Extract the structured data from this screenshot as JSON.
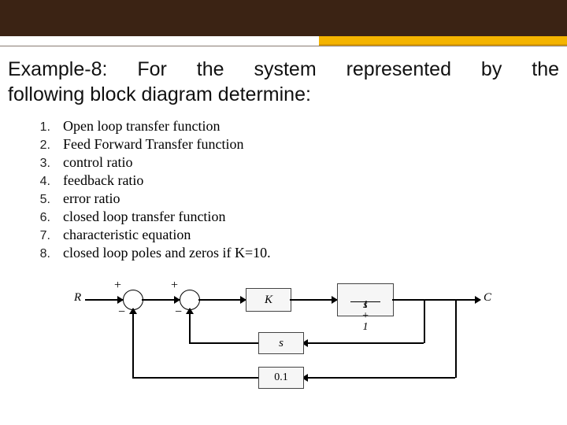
{
  "header": {
    "title_line1": "Example-8: For the system represented by the",
    "title_line2": "following block diagram determine:"
  },
  "list": {
    "items": [
      {
        "n": "1.",
        "text": "Open loop transfer function"
      },
      {
        "n": "2.",
        "text": "Feed Forward Transfer function"
      },
      {
        "n": "3.",
        "text": "control ratio"
      },
      {
        "n": "4.",
        "text": "feedback ratio"
      },
      {
        "n": "5.",
        "text": "error ratio"
      },
      {
        "n": "6.",
        "text": "closed loop transfer function"
      },
      {
        "n": "7.",
        "text": "characteristic equation"
      },
      {
        "n": "8.",
        "text": "closed loop poles and zeros if K=10."
      }
    ]
  },
  "diagram": {
    "input_label": "R",
    "output_label": "C",
    "sum1_plus": "+",
    "sum1_minus": "−",
    "sum2_plus": "+",
    "sum2_minus": "−",
    "block_K": "K",
    "block_tf_num": "1",
    "block_tf_den": "s + 1",
    "block_fb_inner": "s",
    "block_fb_outer": "0.1"
  }
}
